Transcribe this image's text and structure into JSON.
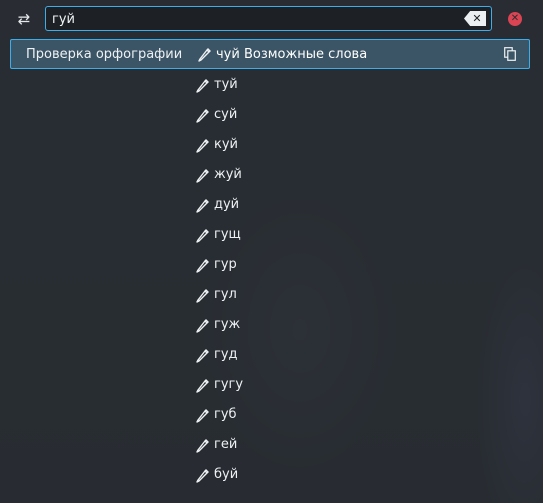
{
  "search": {
    "value": "гуй",
    "clear_label": "✕",
    "close_label": "✕"
  },
  "config_icon": "⇄",
  "result": {
    "category": "Проверка орфографии",
    "suggestion": "чуй",
    "note": "Возможные слова"
  },
  "suggestions": [
    "туй",
    "суй",
    "куй",
    "жуй",
    "дуй",
    "гущ",
    "гур",
    "гул",
    "гуж",
    "гуд",
    "гугу",
    "губ",
    "гей",
    "буй"
  ],
  "colors": {
    "accent": "#3daee9",
    "close": "#da4453",
    "selected_bg": "#3b5566"
  }
}
